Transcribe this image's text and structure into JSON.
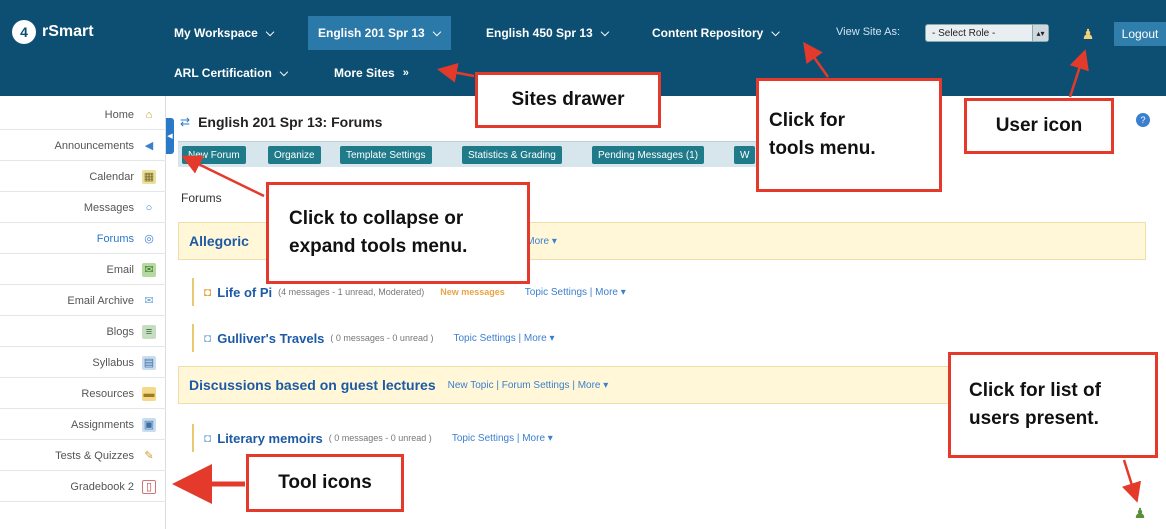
{
  "header": {
    "logo_text": "rSmart",
    "logo_mark": "4",
    "sites": [
      {
        "label": "My Workspace"
      },
      {
        "label": "English 201 Spr 13"
      },
      {
        "label": "English 450 Spr 13"
      },
      {
        "label": "Content Repository"
      },
      {
        "label": "ARL Certification"
      },
      {
        "label": "More Sites"
      }
    ],
    "view_site_as_label": "View Site As:",
    "role_select_value": "- Select Role -",
    "logout_label": "Logout",
    "user_icon": "user-icon"
  },
  "sidebar": {
    "items": [
      {
        "label": "Home",
        "icon": "home-icon"
      },
      {
        "label": "Announcements",
        "icon": "announcement-icon"
      },
      {
        "label": "Calendar",
        "icon": "calendar-icon"
      },
      {
        "label": "Messages",
        "icon": "speech-bubble-icon"
      },
      {
        "label": "Forums",
        "icon": "forum-icon"
      },
      {
        "label": "Email",
        "icon": "email-icon"
      },
      {
        "label": "Email Archive",
        "icon": "envelope-icon"
      },
      {
        "label": "Blogs",
        "icon": "blog-icon"
      },
      {
        "label": "Syllabus",
        "icon": "syllabus-icon"
      },
      {
        "label": "Resources",
        "icon": "folder-icon"
      },
      {
        "label": "Assignments",
        "icon": "assignment-icon"
      },
      {
        "label": "Tests & Quizzes",
        "icon": "pencil-icon"
      },
      {
        "label": "Gradebook 2",
        "icon": "gradebook-icon"
      }
    ]
  },
  "main": {
    "page_title": "English 201 Spr 13: Forums",
    "toolbar": [
      {
        "label": "New Forum"
      },
      {
        "label": "Organize"
      },
      {
        "label": "Template Settings"
      },
      {
        "label": "Statistics & Grading"
      },
      {
        "label": "Pending Messages (1)"
      },
      {
        "label": "W"
      }
    ],
    "section_label": "Forums",
    "forums": [
      {
        "title": "Allegoric",
        "links": "| More ▾",
        "topics": [
          {
            "title": "Life of Pi",
            "meta": "(4 messages - 1 unread, Moderated)",
            "new_label": "New messages",
            "links": "Topic Settings | More ▾"
          },
          {
            "title": "Gulliver's Travels",
            "meta": "( 0 messages - 0 unread )",
            "links": "Topic Settings | More ▾"
          }
        ]
      },
      {
        "title": "Discussions based on guest lectures",
        "links": "New Topic | Forum Settings | More ▾",
        "topics": [
          {
            "title": "Literary memoirs",
            "meta": "( 0 messages - 0 unread )",
            "links": "Topic Settings | More ▾"
          }
        ]
      }
    ]
  },
  "callouts": {
    "sites_drawer": "Sites drawer",
    "tools_menu_line1": "Click for",
    "tools_menu_line2": "tools menu.",
    "user_icon": "User icon",
    "collapse_line1": "Click to collapse or",
    "collapse_line2": "expand tools menu.",
    "users_present_line1": "Click for list of",
    "users_present_line2": "users present.",
    "tool_icons": "Tool icons"
  },
  "colors": {
    "header_bg": "#0d4f73",
    "active_tab": "#2a79a8",
    "callout_border": "#e33a2b",
    "forum_bar_bg": "#fff7d8",
    "link_blue": "#1c5aa6"
  }
}
